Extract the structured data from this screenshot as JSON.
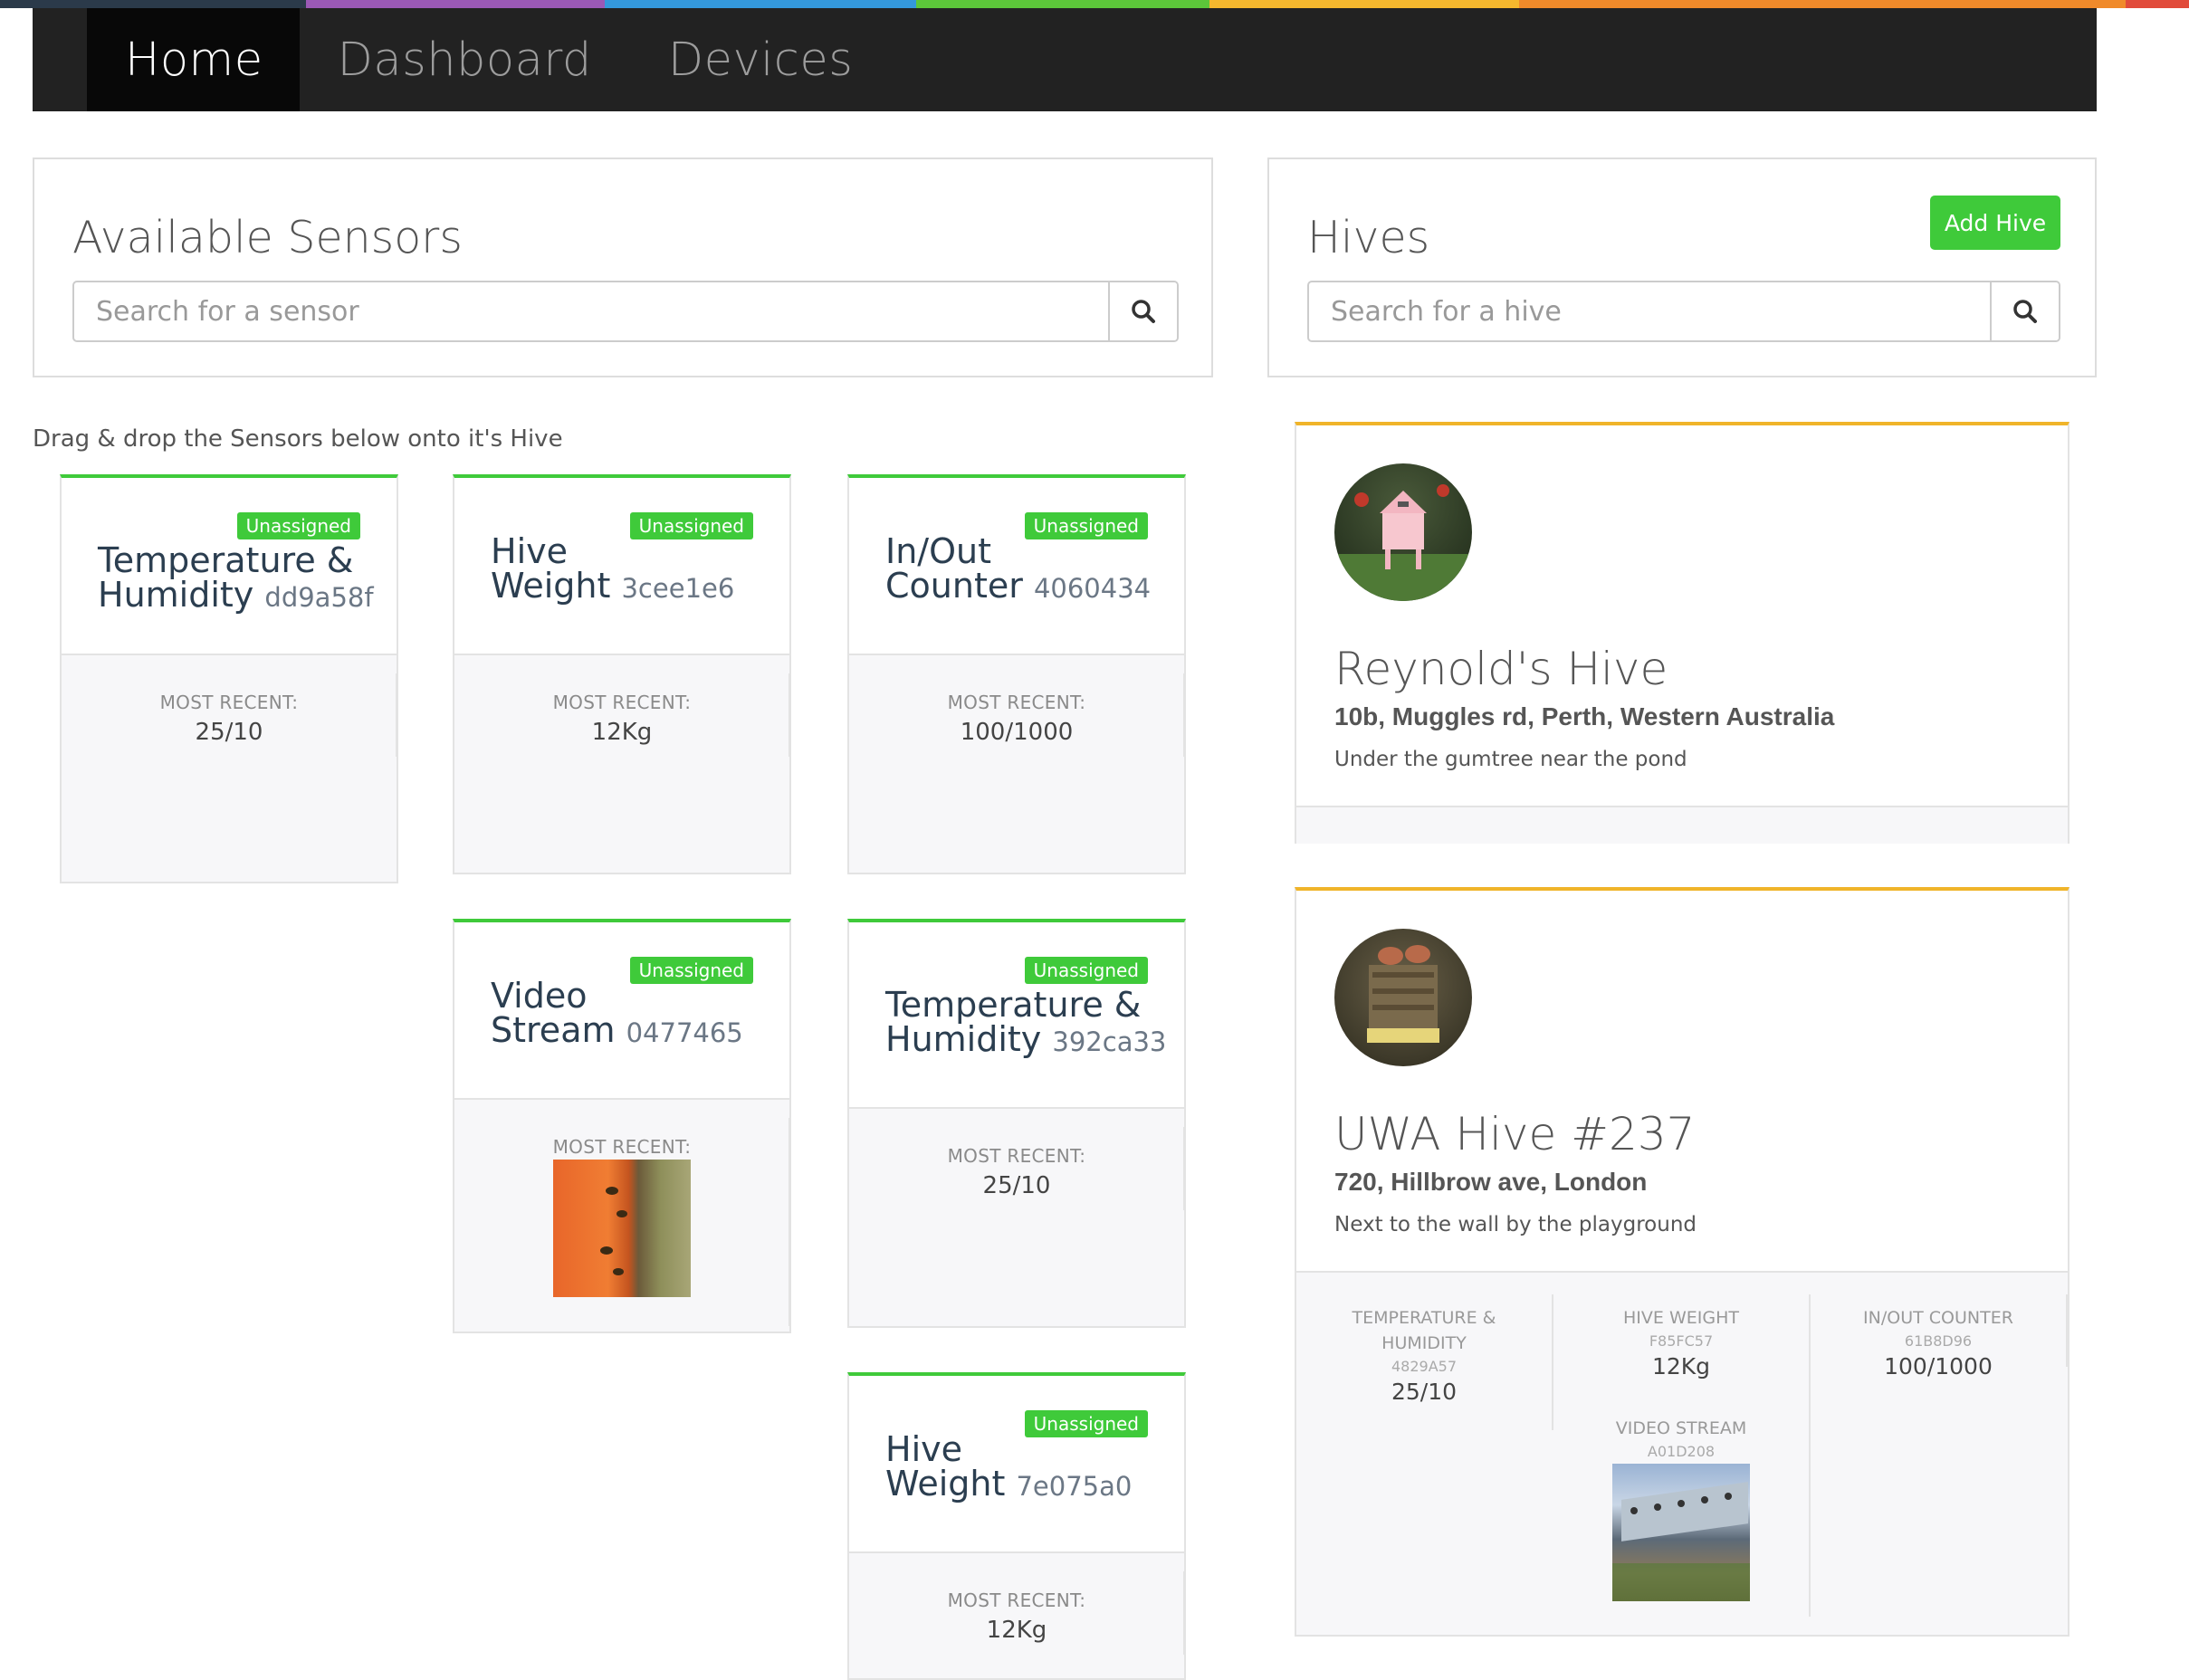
{
  "colors": {
    "strip": [
      "#2b3a4a",
      "#9b59b6",
      "#3498db",
      "#5cc63a",
      "#f5b82e",
      "#f08a2a",
      "#e14b3a"
    ],
    "accent_green": "#3fca3a",
    "hive_border": "#f0b429",
    "navbar": "#222222"
  },
  "nav": {
    "items": [
      "Home",
      "Dashboard",
      "Devices"
    ],
    "active": "Home"
  },
  "sensors_panel": {
    "title": "Available Sensors",
    "search_placeholder": "Search for a sensor",
    "search_icon": "search-icon"
  },
  "hives_panel": {
    "title": "Hives",
    "add_button": "Add Hive",
    "search_placeholder": "Search for a hive",
    "search_icon": "search-icon"
  },
  "hint": "Drag & drop the Sensors below onto it's Hive",
  "sensors": [
    {
      "name_line1": "Temperature &",
      "name_line2": "Humidity",
      "id": "dd9a58f",
      "badge": "Unassigned",
      "recent_label": "MOST RECENT:",
      "recent_value": "25/10"
    },
    {
      "name_line1": "Hive",
      "name_line2": "Weight",
      "id": "3cee1e6",
      "badge": "Unassigned",
      "recent_label": "MOST RECENT:",
      "recent_value": "12Kg"
    },
    {
      "name_line1": "In/Out",
      "name_line2": "Counter",
      "id": "4060434",
      "badge": "Unassigned",
      "recent_label": "MOST RECENT:",
      "recent_value": "100/1000"
    },
    {
      "name_line1": "Video",
      "name_line2": "Stream",
      "id": "0477465",
      "badge": "Unassigned",
      "recent_label": "MOST RECENT:",
      "recent_value": "",
      "image": "bees-entrance-thumbnail"
    },
    {
      "name_line1": "Temperature &",
      "name_line2": "Humidity",
      "id": "392ca33",
      "badge": "Unassigned",
      "recent_label": "MOST RECENT:",
      "recent_value": "25/10"
    },
    {
      "name_line1": "Hive",
      "name_line2": "Weight",
      "id": "7e075a0",
      "badge": "Unassigned",
      "recent_label": "MOST RECENT:",
      "recent_value": "12Kg"
    }
  ],
  "hives": [
    {
      "name": "Reynold's Hive",
      "address": "10b, Muggles rd, Perth, Western Australia",
      "note": "Under the gumtree near the pond",
      "image": "pink-hive-photo"
    },
    {
      "name": "UWA Hive #237",
      "address": "720, Hillbrow ave, London",
      "note": "Next to the wall by the playground",
      "image": "wooden-hive-photo",
      "sensors": [
        {
          "name_line1": "TEMPERATURE &",
          "name_line2": "HUMIDITY",
          "id": "4829A57",
          "value": "25/10"
        },
        {
          "name_line1": "HIVE WEIGHT",
          "name_line2": "",
          "id": "F85FC57",
          "value": "12Kg"
        },
        {
          "name_line1": "IN/OUT COUNTER",
          "name_line2": "",
          "id": "61B8D96",
          "value": "100/1000"
        },
        {
          "name_line1": "VIDEO STREAM",
          "name_line2": "",
          "id": "A01D208",
          "value": "",
          "image": "hive-video-thumbnail"
        }
      ]
    }
  ]
}
